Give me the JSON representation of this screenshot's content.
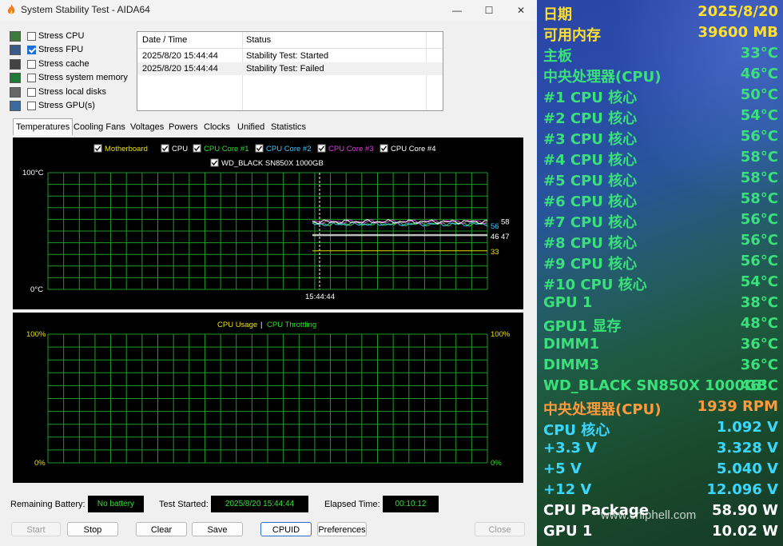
{
  "window": {
    "title": "System Stability Test - AIDA64",
    "min": "—",
    "max": "☐",
    "close": "✕"
  },
  "stress_options": [
    {
      "label": "Stress CPU",
      "checked": false
    },
    {
      "label": "Stress FPU",
      "checked": true
    },
    {
      "label": "Stress cache",
      "checked": false
    },
    {
      "label": "Stress system memory",
      "checked": false
    },
    {
      "label": "Stress local disks",
      "checked": false
    },
    {
      "label": "Stress GPU(s)",
      "checked": false
    }
  ],
  "log": {
    "headers": [
      "Date / Time",
      "Status"
    ],
    "rows": [
      {
        "time": "2025/8/20 15:44:44",
        "status": "Stability Test: Started"
      },
      {
        "time": "2025/8/20 15:44:44",
        "status": "Stability Test: Failed"
      }
    ]
  },
  "tabs": [
    "Temperatures",
    "Cooling Fans",
    "Voltages",
    "Powers",
    "Clocks",
    "Unified",
    "Statistics"
  ],
  "temp_chart": {
    "legend": [
      {
        "label": "Motherboard",
        "color": "#e8e000"
      },
      {
        "label": "CPU",
        "color": "#ffffff"
      },
      {
        "label": "CPU Core #1",
        "color": "#30e030"
      },
      {
        "label": "CPU Core #2",
        "color": "#40c8ff"
      },
      {
        "label": "CPU Core #3",
        "color": "#e040e0"
      },
      {
        "label": "CPU Core #4",
        "color": "#ffffff"
      },
      {
        "label": "WD_BLACK SN850X 1000GB",
        "color": "#ffffff"
      }
    ],
    "ymax_label": "100°C",
    "ymin_label": "0°C",
    "x_label": "15:44:44",
    "value_labels": [
      {
        "text": "58",
        "color": "#ffffff"
      },
      {
        "text": "56",
        "color": "#40c8ff"
      },
      {
        "text": "46",
        "color": "#ffffff"
      },
      {
        "text": "47",
        "color": "#ffffff"
      },
      {
        "text": "33",
        "color": "#e8e000"
      }
    ]
  },
  "usage_chart": {
    "legend_a": "CPU Usage",
    "legend_sep": "|",
    "legend_b": "CPU Throttling",
    "left_top": "100%",
    "left_bottom": "0%",
    "right_top": "100%",
    "right_bottom": "0%"
  },
  "chart_data": [
    {
      "type": "line",
      "title": "",
      "ylim": [
        0,
        100
      ],
      "x": [
        "15:44:44"
      ],
      "series": [
        {
          "name": "Motherboard",
          "values": [
            33
          ]
        },
        {
          "name": "CPU",
          "values": [
            46
          ]
        },
        {
          "name": "CPU Core #1",
          "values": [
            56
          ]
        },
        {
          "name": "CPU Core #2",
          "values": [
            56
          ]
        },
        {
          "name": "CPU Core #3",
          "values": [
            58
          ]
        },
        {
          "name": "CPU Core #4",
          "values": [
            58
          ]
        },
        {
          "name": "WD_BLACK SN850X 1000GB",
          "values": [
            47
          ]
        }
      ]
    },
    {
      "type": "line",
      "title": "",
      "ylim": [
        0,
        100
      ],
      "series": [
        {
          "name": "CPU Usage",
          "values": []
        },
        {
          "name": "CPU Throttling",
          "values": []
        }
      ]
    }
  ],
  "bottom": {
    "battery_label": "Remaining Battery:",
    "battery_value": "No battery",
    "started_label": "Test Started:",
    "started_value": "2025/8/20 15:44:44",
    "elapsed_label": "Elapsed Time:",
    "elapsed_value": "00:10:12"
  },
  "buttons": {
    "start": "Start",
    "stop": "Stop",
    "clear": "Clear",
    "save": "Save",
    "cpuid": "CPUID",
    "preferences": "Preferences",
    "close": "Close"
  },
  "sensors": [
    {
      "k": "日期",
      "v": "2025/8/20",
      "kc": "#ffe030",
      "vc": "#ffe030"
    },
    {
      "k": "可用内存",
      "v": "39600 MB",
      "kc": "#ffe030",
      "vc": "#ffe030"
    },
    {
      "k": "主板",
      "v": "33°C",
      "kc": "#3ae07a",
      "vc": "#3ae07a"
    },
    {
      "k": "中央处理器(CPU)",
      "v": "46°C",
      "kc": "#3ae07a",
      "vc": "#3ae07a"
    },
    {
      "k": " #1 CPU 核心",
      "v": "50°C",
      "kc": "#3ae07a",
      "vc": "#3ae07a"
    },
    {
      "k": " #2 CPU 核心",
      "v": "54°C",
      "kc": "#3ae07a",
      "vc": "#3ae07a"
    },
    {
      "k": " #3 CPU 核心",
      "v": "56°C",
      "kc": "#3ae07a",
      "vc": "#3ae07a"
    },
    {
      "k": " #4 CPU 核心",
      "v": "58°C",
      "kc": "#3ae07a",
      "vc": "#3ae07a"
    },
    {
      "k": " #5 CPU 核心",
      "v": "58°C",
      "kc": "#3ae07a",
      "vc": "#3ae07a"
    },
    {
      "k": " #6 CPU 核心",
      "v": "58°C",
      "kc": "#3ae07a",
      "vc": "#3ae07a"
    },
    {
      "k": " #7 CPU 核心",
      "v": "56°C",
      "kc": "#3ae07a",
      "vc": "#3ae07a"
    },
    {
      "k": " #8 CPU 核心",
      "v": "56°C",
      "kc": "#3ae07a",
      "vc": "#3ae07a"
    },
    {
      "k": " #9 CPU 核心",
      "v": "56°C",
      "kc": "#3ae07a",
      "vc": "#3ae07a"
    },
    {
      "k": " #10 CPU 核心",
      "v": "54°C",
      "kc": "#3ae07a",
      "vc": "#3ae07a"
    },
    {
      "k": "GPU 1",
      "v": "38°C",
      "kc": "#3ae07a",
      "vc": "#3ae07a"
    },
    {
      "k": "GPU1 显存",
      "v": "48°C",
      "kc": "#3ae07a",
      "vc": "#3ae07a"
    },
    {
      "k": "DIMM1",
      "v": "36°C",
      "kc": "#3ae07a",
      "vc": "#3ae07a"
    },
    {
      "k": "DIMM3",
      "v": "36°C",
      "kc": "#3ae07a",
      "vc": "#3ae07a"
    },
    {
      "k": "WD_BLACK SN850X 1000GB",
      "v": "46°C",
      "kc": "#3ae07a",
      "vc": "#3ae07a"
    },
    {
      "k": "中央处理器(CPU)",
      "v": "1939 RPM",
      "kc": "#ff9a3c",
      "vc": "#ff9a3c"
    },
    {
      "k": "CPU 核心",
      "v": "1.092 V",
      "kc": "#3ad8ff",
      "vc": "#3ad8ff"
    },
    {
      "k": "+3.3 V",
      "v": "3.328 V",
      "kc": "#3ad8ff",
      "vc": "#3ad8ff"
    },
    {
      "k": "+5 V",
      "v": "5.040 V",
      "kc": "#3ad8ff",
      "vc": "#3ad8ff"
    },
    {
      "k": "+12 V",
      "v": "12.096 V",
      "kc": "#3ad8ff",
      "vc": "#3ad8ff"
    },
    {
      "k": "CPU Package",
      "v": "58.90 W",
      "kc": "#ffffff",
      "vc": "#ffffff"
    },
    {
      "k": "GPU 1",
      "v": "10.02 W",
      "kc": "#ffffff",
      "vc": "#ffffff"
    }
  ],
  "watermark": "www.chiphell.com"
}
